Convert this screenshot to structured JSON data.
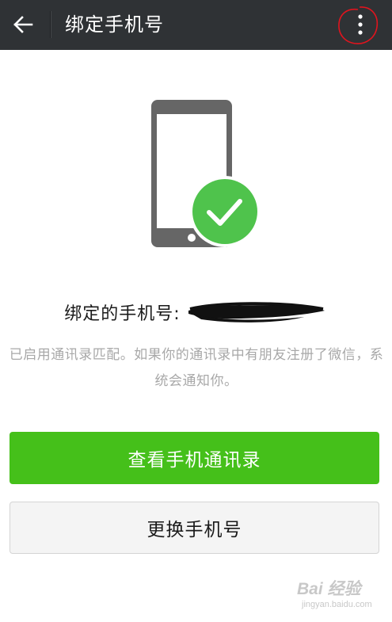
{
  "header": {
    "title": "绑定手机号",
    "back_icon": "arrow-left-icon",
    "more_icon": "more-vertical-icon"
  },
  "phone_illustration": {
    "icon": "smartphone-icon",
    "badge_icon": "checkmark-icon",
    "badge_color": "#4fc34c",
    "phone_color": "#666666"
  },
  "bound_number": {
    "label": "绑定的手机号:"
  },
  "description": "已启用通讯录匹配。如果你的通讯录中有朋友注册了微信，系统会通知你。",
  "buttons": {
    "view_contacts": "查看手机通讯录",
    "change_number": "更换手机号"
  },
  "watermark": {
    "brand": "Bai 经验",
    "url": "jingyan.baidu.com"
  },
  "colors": {
    "topbar": "#2f3235",
    "primary": "#45c01a",
    "annotation_red": "#e0141e"
  }
}
